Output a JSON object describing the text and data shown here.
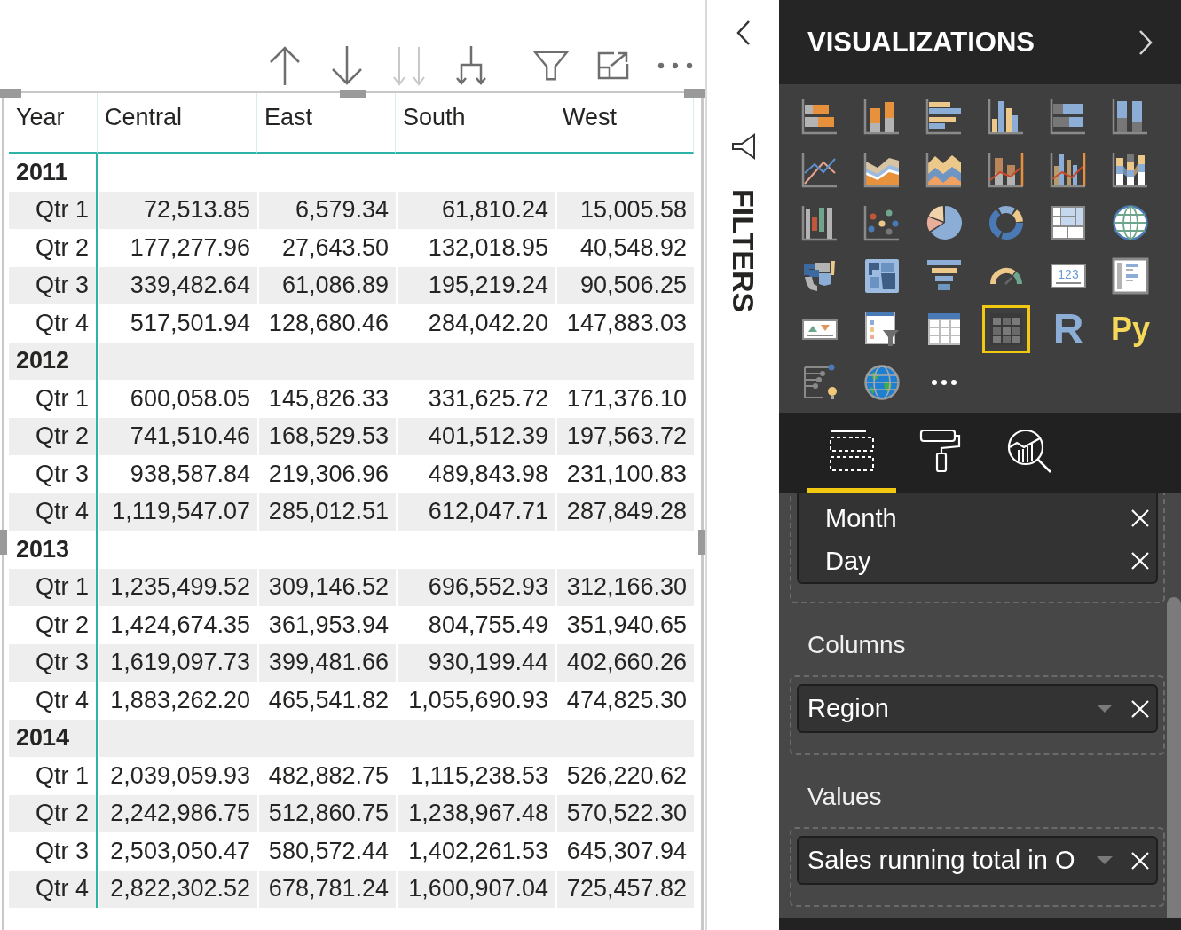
{
  "visual_header": {
    "buttons": [
      {
        "kind": "drill-up",
        "disabled": false
      },
      {
        "kind": "drill-down",
        "disabled": false
      },
      {
        "kind": "next-level",
        "disabled": true
      },
      {
        "kind": "expand-next-level",
        "disabled": false
      },
      {
        "kind": "filter",
        "disabled": false
      },
      {
        "kind": "focus-mode",
        "disabled": false
      },
      {
        "kind": "more-options",
        "disabled": false
      }
    ]
  },
  "table": {
    "columns": [
      "Year",
      "Central",
      "East",
      "South",
      "West"
    ],
    "rows": [
      {
        "label": "2011",
        "children": [
          {
            "label": "Qtr 1",
            "values": [
              "72,513.85",
              "6,579.34",
              "61,810.24",
              "15,005.58"
            ]
          },
          {
            "label": "Qtr 2",
            "values": [
              "177,277.96",
              "27,643.50",
              "132,018.95",
              "40,548.92"
            ]
          },
          {
            "label": "Qtr 3",
            "values": [
              "339,482.64",
              "61,086.89",
              "195,219.24",
              "90,506.25"
            ]
          },
          {
            "label": "Qtr 4",
            "values": [
              "517,501.94",
              "128,680.46",
              "284,042.20",
              "147,883.03"
            ]
          }
        ]
      },
      {
        "label": "2012",
        "children": [
          {
            "label": "Qtr 1",
            "values": [
              "600,058.05",
              "145,826.33",
              "331,625.72",
              "171,376.10"
            ]
          },
          {
            "label": "Qtr 2",
            "values": [
              "741,510.46",
              "168,529.53",
              "401,512.39",
              "197,563.72"
            ]
          },
          {
            "label": "Qtr 3",
            "values": [
              "938,587.84",
              "219,306.96",
              "489,843.98",
              "231,100.83"
            ]
          },
          {
            "label": "Qtr 4",
            "values": [
              "1,119,547.07",
              "285,012.51",
              "612,047.71",
              "287,849.28"
            ]
          }
        ]
      },
      {
        "label": "2013",
        "children": [
          {
            "label": "Qtr 1",
            "values": [
              "1,235,499.52",
              "309,146.52",
              "696,552.93",
              "312,166.30"
            ]
          },
          {
            "label": "Qtr 2",
            "values": [
              "1,424,674.35",
              "361,953.94",
              "804,755.49",
              "351,940.65"
            ]
          },
          {
            "label": "Qtr 3",
            "values": [
              "1,619,097.73",
              "399,481.66",
              "930,199.44",
              "402,660.26"
            ]
          },
          {
            "label": "Qtr 4",
            "values": [
              "1,883,262.20",
              "465,541.82",
              "1,055,690.93",
              "474,825.30"
            ]
          }
        ]
      },
      {
        "label": "2014",
        "children": [
          {
            "label": "Qtr 1",
            "values": [
              "2,039,059.93",
              "482,882.75",
              "1,115,238.53",
              "526,220.62"
            ]
          },
          {
            "label": "Qtr 2",
            "values": [
              "2,242,986.75",
              "512,860.75",
              "1,238,967.48",
              "570,522.30"
            ]
          },
          {
            "label": "Qtr 3",
            "values": [
              "2,503,050.47",
              "580,572.44",
              "1,402,261.53",
              "645,307.94"
            ]
          },
          {
            "label": "Qtr 4",
            "values": [
              "2,822,302.52",
              "678,781.24",
              "1,600,907.04",
              "725,457.82"
            ]
          }
        ]
      }
    ]
  },
  "filters_pane": {
    "title": "FILTERS"
  },
  "visualizations_pane": {
    "title": "VISUALIZATIONS",
    "visuals": [
      {
        "kind": "stacked-bar",
        "selected": false
      },
      {
        "kind": "stacked-column",
        "selected": false
      },
      {
        "kind": "clustered-bar",
        "selected": false
      },
      {
        "kind": "clustered-column",
        "selected": false
      },
      {
        "kind": "percent-bar",
        "selected": false
      },
      {
        "kind": "percent-column",
        "selected": false
      },
      {
        "kind": "line",
        "selected": false
      },
      {
        "kind": "area",
        "selected": false
      },
      {
        "kind": "stacked-area",
        "selected": false
      },
      {
        "kind": "line-stacked-column",
        "selected": false
      },
      {
        "kind": "line-clustered-column",
        "selected": false
      },
      {
        "kind": "ribbon",
        "selected": false
      },
      {
        "kind": "waterfall",
        "selected": false
      },
      {
        "kind": "scatter",
        "selected": false
      },
      {
        "kind": "pie",
        "selected": false
      },
      {
        "kind": "donut",
        "selected": false
      },
      {
        "kind": "treemap",
        "selected": false
      },
      {
        "kind": "map",
        "selected": false
      },
      {
        "kind": "filled-map",
        "selected": false
      },
      {
        "kind": "shape-map",
        "selected": false
      },
      {
        "kind": "funnel",
        "selected": false
      },
      {
        "kind": "gauge",
        "selected": false
      },
      {
        "kind": "card",
        "label": "123",
        "selected": false
      },
      {
        "kind": "multi-row-card",
        "selected": false
      },
      {
        "kind": "kpi",
        "selected": false
      },
      {
        "kind": "slicer",
        "selected": false
      },
      {
        "kind": "table",
        "selected": false
      },
      {
        "kind": "matrix",
        "selected": true
      },
      {
        "kind": "r-script",
        "label": "R",
        "selected": false
      },
      {
        "kind": "python",
        "label": "Py",
        "selected": false
      },
      {
        "kind": "key-influencers",
        "selected": false
      },
      {
        "kind": "arcgis-map",
        "selected": false
      },
      {
        "kind": "more",
        "selected": false
      }
    ],
    "tabs": [
      {
        "kind": "fields",
        "selected": true
      },
      {
        "kind": "format",
        "selected": false
      },
      {
        "kind": "analytics",
        "selected": false
      }
    ],
    "wells": [
      {
        "fields": [
          {
            "name": "Month",
            "dropdown": false
          },
          {
            "name": "Day",
            "dropdown": false
          }
        ]
      },
      {
        "label": "Columns",
        "fields": [
          {
            "name": "Region",
            "dropdown": true
          }
        ]
      },
      {
        "label": "Values",
        "fields": [
          {
            "name": "Sales running total in O",
            "dropdown": true
          }
        ]
      }
    ]
  }
}
